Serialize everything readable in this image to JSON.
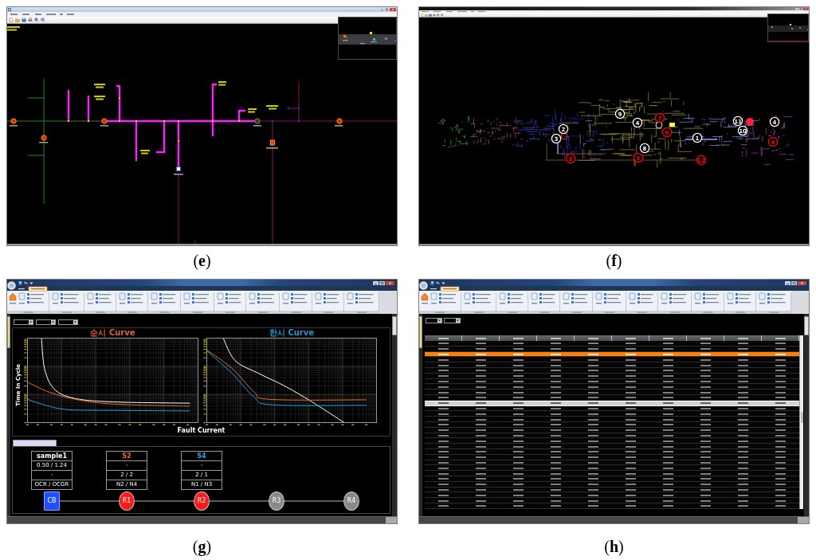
{
  "panel_e": {
    "caption": "(**e**)"
  },
  "panel_f": {
    "caption": "(**f**)",
    "markers": [
      {
        "text": "9",
        "color": "#ffffff"
      },
      {
        "text": "7",
        "color": "#ff0000"
      },
      {
        "text": "4",
        "color": "#ffffff"
      },
      {
        "text": "6",
        "color": "#ff0000"
      },
      {
        "text": "2",
        "color": "#ffffff"
      },
      {
        "text": "3",
        "color": "#ffffff"
      },
      {
        "text": "3",
        "color": "#ff0000"
      },
      {
        "text": "8",
        "color": "#ffffff"
      },
      {
        "text": "5",
        "color": "#ff0000"
      },
      {
        "text": "1",
        "color": "#ffffff"
      },
      {
        "text": "12",
        "color": "#ff0000"
      },
      {
        "text": "11",
        "color": "#ffffff"
      },
      {
        "text": "10",
        "color": "#ffffff"
      },
      {
        "text": "4",
        "color": "#ffffff"
      },
      {
        "text": "4",
        "color": "#ff0000"
      }
    ]
  },
  "panel_g": {
    "caption": "(**g**)",
    "charts": [
      {
        "title": "순시 Curve",
        "color": "#e0642a"
      },
      {
        "title": "한시 Curve",
        "color": "#1a9ad0"
      }
    ],
    "y_axis_label": "Time In Cycle",
    "x_axis_label": "Fault Current",
    "relay_cards": [
      {
        "title": "sample1",
        "color": "#ffffff",
        "values": [
          "0.50 / 1.24",
          "-",
          "OCR / OCGR"
        ]
      },
      {
        "title": "S2",
        "color": "#f06a28",
        "values": [
          "-",
          "2 / 2",
          "N2 / N4"
        ]
      },
      {
        "title": "S4",
        "color": "#1aa6e0",
        "values": [
          "-",
          "2 / 1",
          "N1 / N3"
        ]
      }
    ],
    "nodes": [
      {
        "text": "CB",
        "kind": "square",
        "color": "#1f4fff"
      },
      {
        "text": "R1",
        "kind": "circle",
        "color": "#ff1a1a"
      },
      {
        "text": "R2",
        "kind": "circle",
        "color": "#ff1a1a"
      },
      {
        "text": "R3",
        "kind": "circle",
        "color": "#8a8a8a"
      },
      {
        "text": "R4",
        "kind": "circle",
        "color": "#8a8a8a"
      }
    ]
  },
  "panel_h": {
    "caption": "(**h**)",
    "table": {
      "rows": [
        {
          "selected": false,
          "highlighted": false
        },
        {
          "selected": false,
          "highlighted": false
        },
        {
          "selected": true,
          "highlighted": false
        },
        {
          "selected": false,
          "highlighted": false
        },
        {
          "selected": false,
          "highlighted": false
        },
        {
          "selected": false,
          "highlighted": false
        },
        {
          "selected": false,
          "highlighted": false
        },
        {
          "selected": false,
          "highlighted": false
        },
        {
          "selected": false,
          "highlighted": false
        },
        {
          "selected": false,
          "highlighted": false
        },
        {
          "selected": false,
          "highlighted": false
        },
        {
          "selected": false,
          "highlighted": true
        },
        {
          "selected": false,
          "highlighted": false
        },
        {
          "selected": false,
          "highlighted": false
        },
        {
          "selected": false,
          "highlighted": false
        },
        {
          "selected": false,
          "highlighted": false
        },
        {
          "selected": false,
          "highlighted": false
        },
        {
          "selected": false,
          "highlighted": false
        },
        {
          "selected": false,
          "highlighted": false
        },
        {
          "selected": false,
          "highlighted": false
        },
        {
          "selected": false,
          "highlighted": false
        },
        {
          "selected": false,
          "highlighted": false
        },
        {
          "selected": false,
          "highlighted": false
        },
        {
          "selected": false,
          "highlighted": false
        },
        {
          "selected": false,
          "highlighted": false
        },
        {
          "selected": false,
          "highlighted": false
        },
        {
          "selected": false,
          "highlighted": false
        },
        {
          "selected": false,
          "highlighted": false
        },
        {
          "selected": false,
          "highlighted": false
        },
        {
          "selected": false,
          "highlighted": false
        },
        {
          "selected": false,
          "highlighted": false
        }
      ]
    }
  }
}
